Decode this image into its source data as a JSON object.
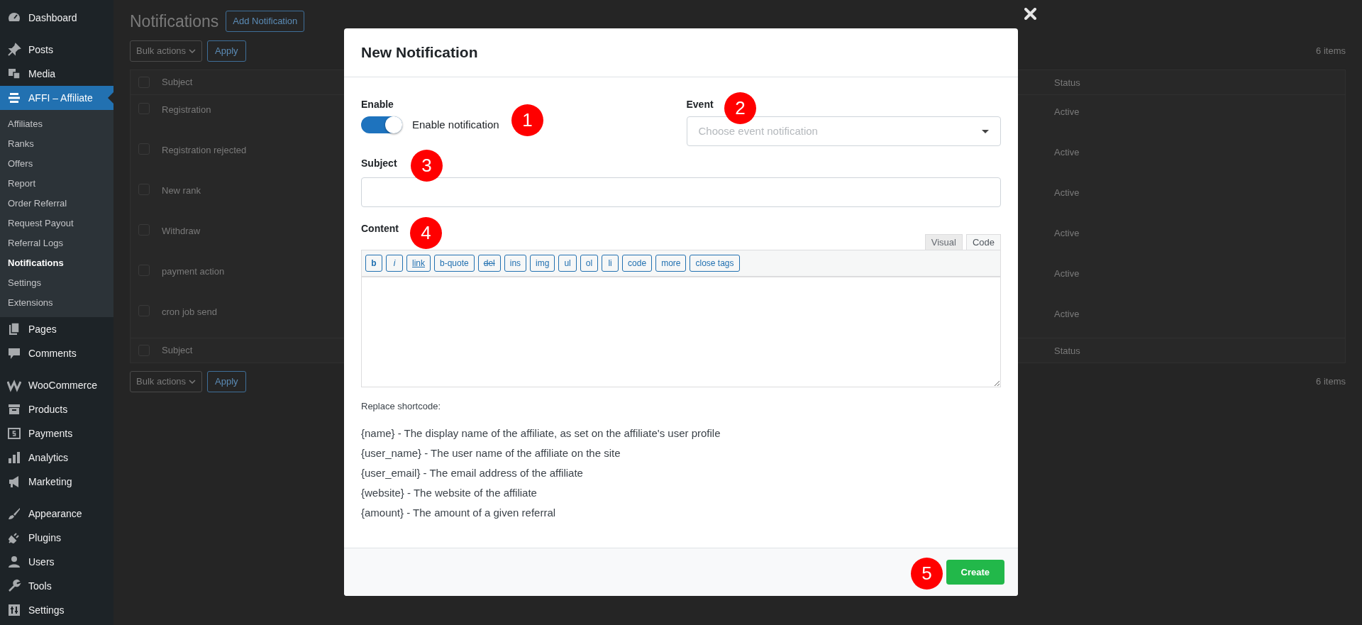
{
  "sidebar": {
    "groups": [
      {
        "items": [
          {
            "label": "Dashboard",
            "selected": false
          }
        ]
      },
      {
        "items": [
          {
            "label": "Posts",
            "selected": false
          },
          {
            "label": "Media",
            "selected": false
          },
          {
            "label": "AFFI – Affiliate",
            "selected": true,
            "children": [
              {
                "label": "Affiliates",
                "selected": false
              },
              {
                "label": "Ranks",
                "selected": false
              },
              {
                "label": "Offers",
                "selected": false
              },
              {
                "label": "Report",
                "selected": false
              },
              {
                "label": "Order Referral",
                "selected": false
              },
              {
                "label": "Request Payout",
                "selected": false
              },
              {
                "label": "Referral Logs",
                "selected": false
              },
              {
                "label": "Notifications",
                "selected": true
              },
              {
                "label": "Settings",
                "selected": false
              },
              {
                "label": "Extensions",
                "selected": false
              }
            ]
          },
          {
            "label": "Pages",
            "selected": false
          },
          {
            "label": "Comments",
            "selected": false
          }
        ]
      },
      {
        "items": [
          {
            "label": "WooCommerce",
            "selected": false
          },
          {
            "label": "Products",
            "selected": false
          },
          {
            "label": "Payments",
            "selected": false
          },
          {
            "label": "Analytics",
            "selected": false
          },
          {
            "label": "Marketing",
            "selected": false
          }
        ]
      },
      {
        "items": [
          {
            "label": "Appearance",
            "selected": false
          },
          {
            "label": "Plugins",
            "selected": false
          },
          {
            "label": "Users",
            "selected": false
          },
          {
            "label": "Tools",
            "selected": false
          },
          {
            "label": "Settings",
            "selected": false
          }
        ]
      }
    ]
  },
  "page": {
    "title": "Notifications",
    "add_button": "Add Notification",
    "top_actions": {
      "bulk_select": "Bulk actions",
      "apply": "Apply",
      "count": "6 items"
    },
    "table": {
      "columns": [
        "Subject",
        "Status"
      ],
      "header_checked": false,
      "rows": [
        {
          "subject": "Registration",
          "status": "Active",
          "checked": false
        },
        {
          "subject": "Registration rejected",
          "status": "Active",
          "checked": false
        },
        {
          "subject": "New rank",
          "status": "Active",
          "checked": false
        },
        {
          "subject": "Withdraw",
          "status": "Active",
          "checked": false
        },
        {
          "subject": "payment action",
          "status": "Active",
          "checked": false
        },
        {
          "subject": "cron job send",
          "status": "Active",
          "checked": false
        }
      ],
      "footer_columns": [
        "Subject",
        "Status"
      ],
      "footer_checked": false
    },
    "bottom_actions": {
      "bulk_select": "Bulk actions",
      "apply": "Apply",
      "count": "6 items"
    }
  },
  "modal": {
    "title": "New Notification",
    "enable": {
      "label": "Enable",
      "on": true,
      "text": "Enable notification"
    },
    "event": {
      "label": "Event",
      "placeholder": "Choose event notification"
    },
    "subject": {
      "label": "Subject"
    },
    "content": {
      "label": "Content",
      "tabs": [
        {
          "label": "Visual",
          "selected": false
        },
        {
          "label": "Code",
          "selected": true
        }
      ],
      "toolbar": [
        {
          "label": "b",
          "kind": "bold"
        },
        {
          "label": "i",
          "kind": "italic"
        },
        {
          "label": "link",
          "kind": "underline"
        },
        {
          "label": "b-quote",
          "kind": "plain"
        },
        {
          "label": "del",
          "kind": "strike"
        },
        {
          "label": "ins",
          "kind": "plain"
        },
        {
          "label": "img",
          "kind": "plain"
        },
        {
          "label": "ul",
          "kind": "plain"
        },
        {
          "label": "ol",
          "kind": "plain"
        },
        {
          "label": "li",
          "kind": "plain"
        },
        {
          "label": "code",
          "kind": "plain"
        },
        {
          "label": "more",
          "kind": "plain"
        },
        {
          "label": "close tags",
          "kind": "plain"
        }
      ]
    },
    "shortcode_note": "Replace shortcode:",
    "shortcodes": [
      "{name} - The display name of the affiliate, as set on the affiliate's user profile",
      "{user_name} - The user name of the affiliate on the site",
      "{user_email} - The email address of the affiliate",
      "{website} - The website of the affiliate",
      "{amount} - The amount of a given referral"
    ],
    "create_button": "Create"
  },
  "annotations": [
    "1",
    "2",
    "3",
    "4",
    "5"
  ]
}
